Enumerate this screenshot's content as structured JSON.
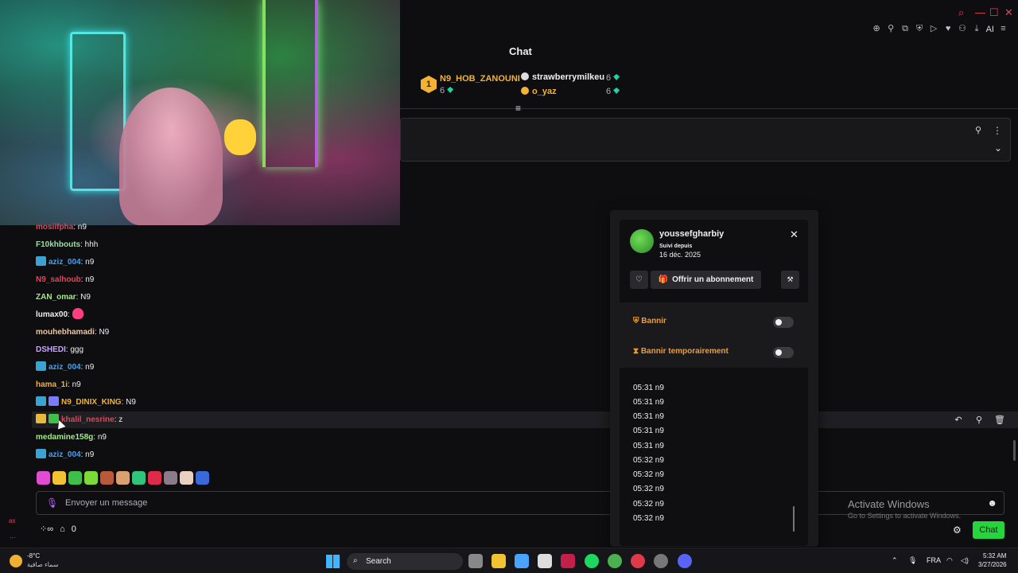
{
  "window": {
    "controls": [
      "⌕",
      "—",
      "☐",
      "✕"
    ],
    "toolbar_icons": [
      "zoom-icon",
      "pin-icon",
      "popout-icon",
      "shield-icon",
      "play-icon",
      "heart-icon",
      "person-icon",
      "download-icon"
    ],
    "ai_label": "AI"
  },
  "chat": {
    "title": "Chat",
    "leaderboard": {
      "first": {
        "rank": "1",
        "name": "N9_HOB_ZANOUNI",
        "count": "6"
      },
      "second": {
        "name": "strawberrymilkeu",
        "count": "6"
      },
      "third": {
        "name": "o_yaz",
        "count": "6"
      }
    },
    "messages": [
      {
        "user": "mosiifpha",
        "text": ": n9",
        "color": "#e0455a"
      },
      {
        "user": "F10khbouts",
        "text": ": hhh",
        "color": "#8fe3a0"
      },
      {
        "user": "aziz_004",
        "text": ": n9",
        "color": "#3aa3ff"
      },
      {
        "user": "N9_salhoub",
        "text": ": n9",
        "color": "#e0455a"
      },
      {
        "user": "ZAN_omar",
        "text": ": N9",
        "color": "#9ef07a"
      },
      {
        "user": "lumax00",
        "text": ":",
        "color": "#efeff1"
      },
      {
        "user": "mouhebhamadi",
        "text": ": N9",
        "color": "#f2c49b"
      },
      {
        "user": "DSHEDI",
        "text": ": ggg",
        "color": "#c9a2ff"
      },
      {
        "user": "aziz_004",
        "text": ": n9",
        "color": "#3aa3ff"
      },
      {
        "user": "hama_1i",
        "text": ": n9",
        "color": "#f2b233"
      },
      {
        "user": "N9_DINIX_KING",
        "text": ": N9",
        "color": "#f2b233"
      },
      {
        "user": "khalil_nesrine",
        "text": ": z",
        "color": "#e0455a"
      },
      {
        "user": "medamine158g",
        "text": ": n9",
        "color": "#9ef07a"
      },
      {
        "user": "aziz_004",
        "text": ": n9",
        "color": "#3aa3ff"
      }
    ],
    "input_placeholder": "Envoyer un message",
    "footer_left_count": "0",
    "chat_button": "Chat"
  },
  "watermark": {
    "title": "Activate Windows",
    "subtitle": "Go to Settings to activate Windows."
  },
  "user_card": {
    "username": "youssefgharbiy",
    "follow_label": "Suivi depuis",
    "follow_date": "16 déc. 2025",
    "gift_label": "Offrir un abonnement",
    "ban_label": "Bannir",
    "timeout_label": "Bannir temporairement",
    "log": [
      "05:31 n9",
      "05:31 n9",
      "05:31 n9",
      "05:31 n9",
      "05:31 n9",
      "05:32 n9",
      "05:32 n9",
      "05:32 n9",
      "05:32 n9",
      "05:32 n9"
    ]
  },
  "taskbar": {
    "temp": "-8°C",
    "weather_desc": "سماء صافية",
    "search_label": "Search",
    "lang": "FRA",
    "time": "5:32 AM",
    "date": "3/27/2026"
  },
  "side": {
    "ax": "ax",
    "dots": "..."
  }
}
